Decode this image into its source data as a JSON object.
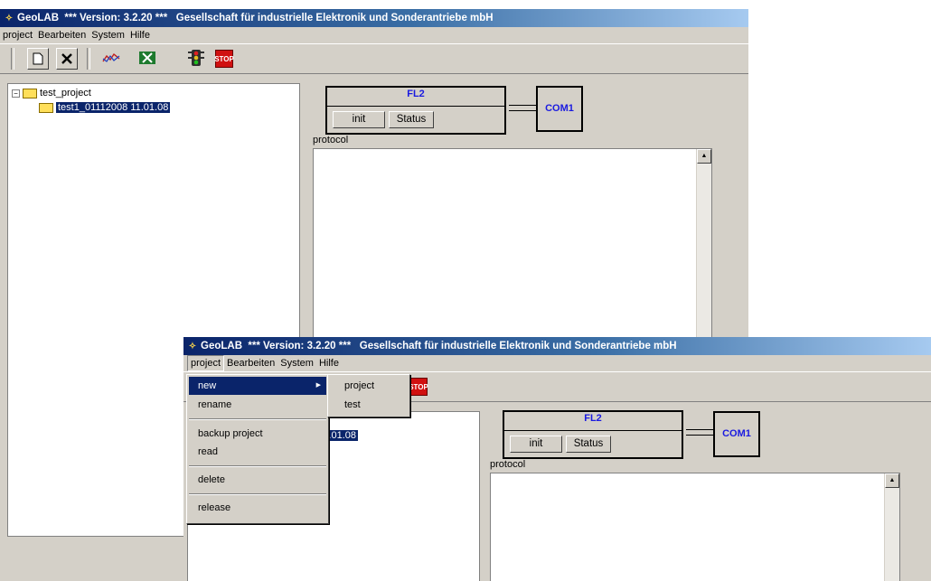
{
  "title": {
    "app": "GeoLAB",
    "version_text": "*** Version: 3.2.20 ***",
    "company": "Gesellschaft für industrielle Elektronik und Sonderantriebe mbH"
  },
  "menu": [
    "project",
    "Bearbeiten",
    "System",
    "Hilfe"
  ],
  "toolbar": [
    "new-icon",
    "delete-icon",
    "chart-icon",
    "excel-icon",
    "traffic-light-icon",
    "stop-icon"
  ],
  "toolbar_stop_label": "STOP",
  "tree": {
    "root": "test_project",
    "child": "test1_01112008 11.01.08",
    "child_partial": "11.01.08"
  },
  "device": {
    "name": "FL2",
    "init_label": "init",
    "status_label": "Status",
    "port": "COM1"
  },
  "protocol_label": "protocol",
  "project_menu": {
    "items": [
      {
        "label": "new",
        "highlighted": true,
        "submenu": true
      },
      {
        "label": "rename"
      },
      {
        "label": "backup project"
      },
      {
        "label": "read"
      },
      {
        "label": "delete"
      },
      {
        "label": "release"
      }
    ],
    "new_submenu": [
      "project",
      "test"
    ]
  }
}
